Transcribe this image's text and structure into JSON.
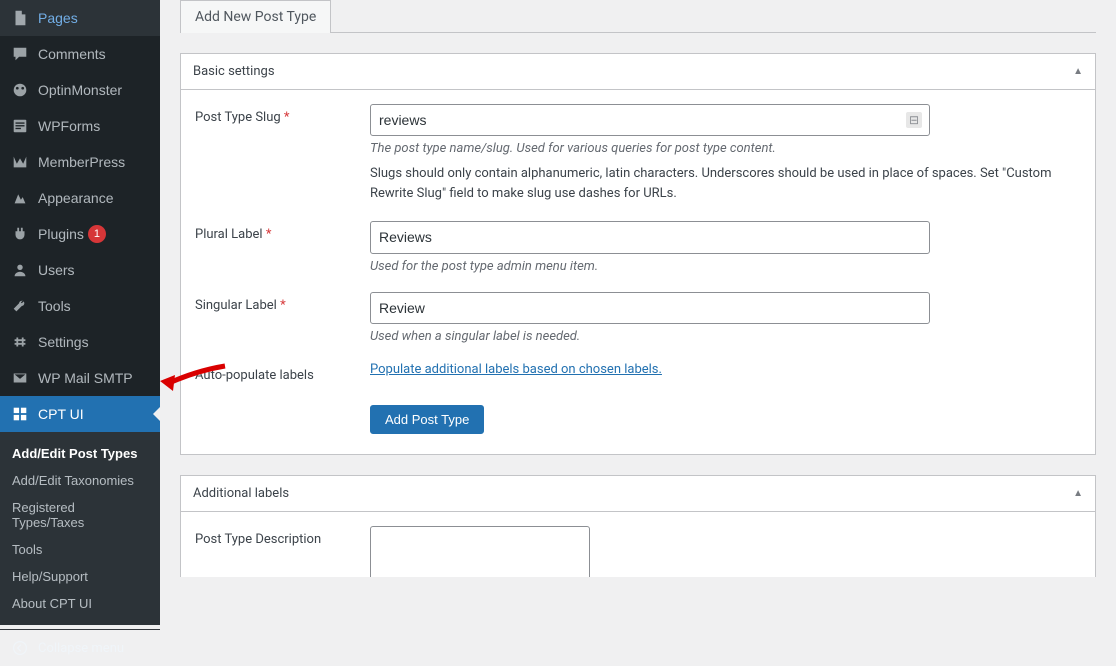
{
  "sidebar": {
    "items": [
      {
        "label": "Pages",
        "icon": "pages"
      },
      {
        "label": "Comments",
        "icon": "comments"
      },
      {
        "label": "OptinMonster",
        "icon": "optinmonster"
      },
      {
        "label": "WPForms",
        "icon": "wpforms"
      },
      {
        "label": "MemberPress",
        "icon": "memberpress"
      },
      {
        "label": "Appearance",
        "icon": "appearance"
      },
      {
        "label": "Plugins",
        "icon": "plugins",
        "badge": "1"
      },
      {
        "label": "Users",
        "icon": "users"
      },
      {
        "label": "Tools",
        "icon": "tools"
      },
      {
        "label": "Settings",
        "icon": "settings"
      },
      {
        "label": "WP Mail SMTP",
        "icon": "mail"
      },
      {
        "label": "CPT UI",
        "icon": "cptui",
        "active": true
      }
    ],
    "submenu": [
      {
        "label": "Add/Edit Post Types",
        "active": true
      },
      {
        "label": "Add/Edit Taxonomies"
      },
      {
        "label": "Registered Types/Taxes"
      },
      {
        "label": "Tools"
      },
      {
        "label": "Help/Support"
      },
      {
        "label": "About CPT UI"
      }
    ],
    "collapse": "Collapse menu"
  },
  "tabs": {
    "add_new": "Add New Post Type"
  },
  "panels": {
    "basic": {
      "title": "Basic settings",
      "fields": {
        "slug_label": "Post Type Slug",
        "slug_value": "reviews",
        "slug_hint": "The post type name/slug. Used for various queries for post type content.",
        "slug_extra": "Slugs should only contain alphanumeric, latin characters. Underscores should be used in place of spaces. Set \"Custom Rewrite Slug\" field to make slug use dashes for URLs.",
        "plural_label": "Plural Label",
        "plural_value": "Reviews",
        "plural_hint": "Used for the post type admin menu item.",
        "singular_label": "Singular Label",
        "singular_value": "Review",
        "singular_hint": "Used when a singular label is needed.",
        "autopop_label": "Auto-populate labels",
        "autopop_link": "Populate additional labels based on chosen labels.",
        "submit": "Add Post Type"
      }
    },
    "additional": {
      "title": "Additional labels",
      "fields": {
        "desc_label": "Post Type Description"
      }
    }
  }
}
